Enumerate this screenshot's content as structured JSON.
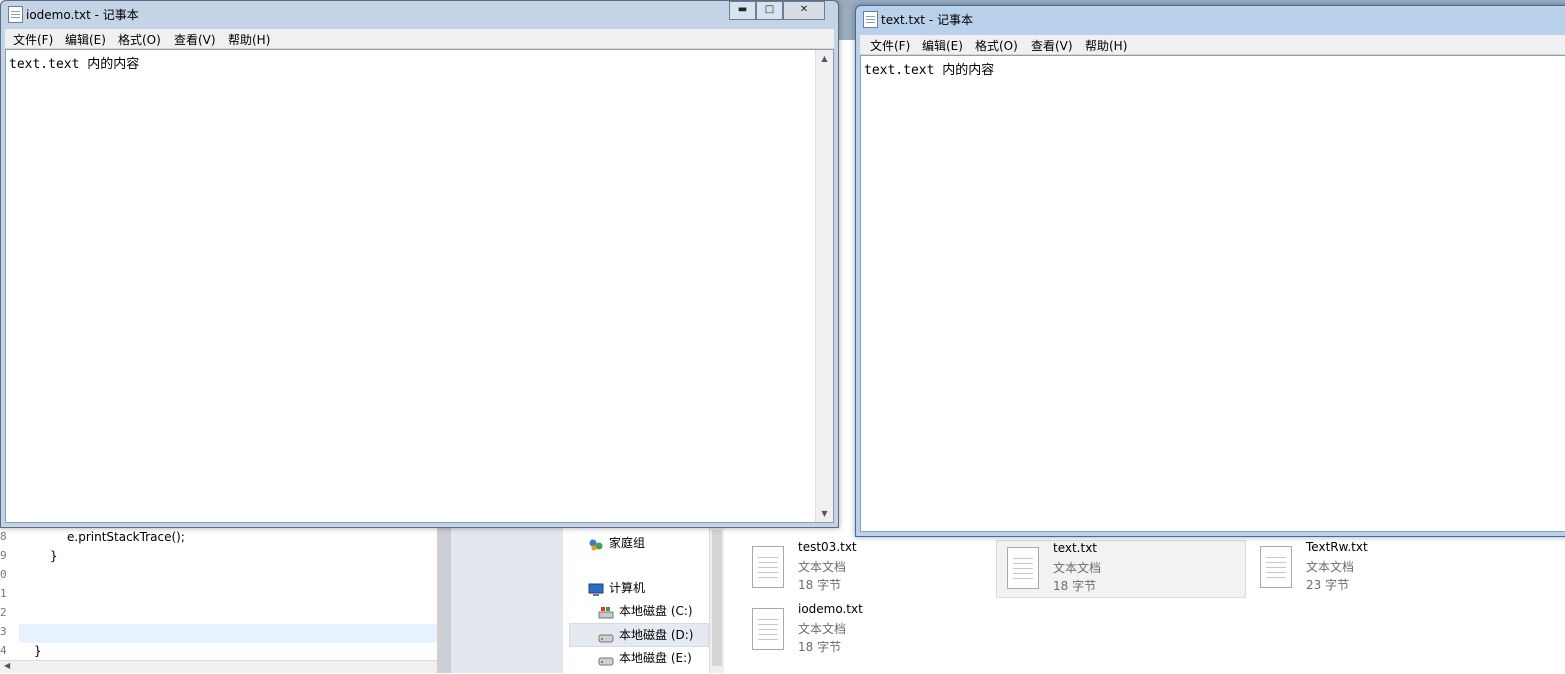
{
  "editor": {
    "lines": [
      {
        "num": "8",
        "code": "e.printStackTrace();"
      },
      {
        "num": "9",
        "code": "}"
      },
      {
        "num": "0",
        "code": ""
      },
      {
        "num": "1",
        "code": ""
      },
      {
        "num": "2",
        "code": ""
      },
      {
        "num": "3",
        "code": ""
      },
      {
        "num": "4",
        "code": "}"
      }
    ]
  },
  "notepad_left": {
    "title": "iodemo.txt - 记事本",
    "menu": [
      "文件(F)",
      "编辑(E)",
      "格式(O)",
      "查看(V)",
      "帮助(H)"
    ],
    "content": "text.text 内的内容",
    "controls": {
      "minimize": "▬",
      "maximize": "□",
      "close": "✕"
    }
  },
  "notepad_right": {
    "title": "text.txt - 记事本",
    "menu": [
      "文件(F)",
      "编辑(E)",
      "格式(O)",
      "查看(V)",
      "帮助(H)"
    ],
    "content": "text.text 内的内容"
  },
  "explorer": {
    "nav": [
      {
        "label": "家庭组",
        "icon": "homegroup-icon"
      },
      {
        "label": "计算机",
        "icon": "computer-icon"
      },
      {
        "label": "本地磁盘 (C:)",
        "icon": "system-drive-icon"
      },
      {
        "label": "本地磁盘 (D:)",
        "icon": "drive-icon",
        "selected": true
      },
      {
        "label": "本地磁盘 (E:)",
        "icon": "drive-icon"
      }
    ],
    "files": [
      {
        "name": "test03.txt",
        "type": "文本文档",
        "size": "18 字节"
      },
      {
        "name": "text.txt",
        "type": "文本文档",
        "size": "18 字节",
        "selected": true
      },
      {
        "name": "TextRw.txt",
        "type": "文本文档",
        "size": "23 字节"
      },
      {
        "name": "iodemo.txt",
        "type": "文本文档",
        "size": "18 字节"
      }
    ]
  },
  "colors": {
    "window_frame": "#c4d3e6",
    "menu_bg": "#f0f0f0",
    "selection": "#e5eaf0",
    "line_highlight": "#e8f2fe"
  }
}
